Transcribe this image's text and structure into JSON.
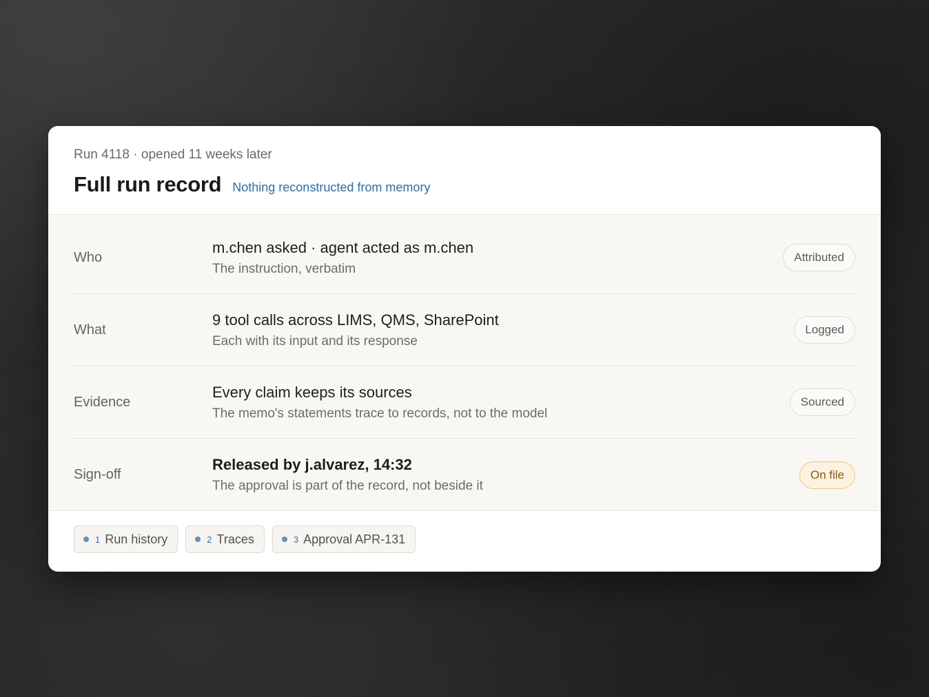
{
  "header": {
    "eyebrow": "Run 4118 · opened 11 weeks later",
    "title": "Full run record",
    "subtitle": "Nothing reconstructed from memory"
  },
  "rows": [
    {
      "label": "Who",
      "title": "m.chen asked · agent acted as m.chen",
      "description": "The instruction, verbatim",
      "badge": "Attributed"
    },
    {
      "label": "What",
      "title": "9 tool calls across LIMS, QMS, SharePoint",
      "description": "Each with its input and its response",
      "badge": "Logged"
    },
    {
      "label": "Evidence",
      "title": "Every claim keeps its sources",
      "description": "The memo's statements trace to records, not to the model",
      "badge": "Sourced"
    },
    {
      "label": "Sign-off",
      "title": "Released by j.alvarez, 14:32",
      "description": "The approval is part of the record, not beside it",
      "badge": "On file"
    }
  ],
  "sources": [
    {
      "number": "1",
      "label": "Run history"
    },
    {
      "number": "2",
      "label": "Traces"
    },
    {
      "number": "3",
      "label": "Approval APR-131"
    }
  ],
  "colors": {
    "accent_link": "#2f6ea3",
    "badge_warm_bg": "#fdf2df",
    "badge_warm_border": "#e9c98d",
    "badge_warm_text": "#8a5a16",
    "source_dot": "#6c8fb3"
  }
}
